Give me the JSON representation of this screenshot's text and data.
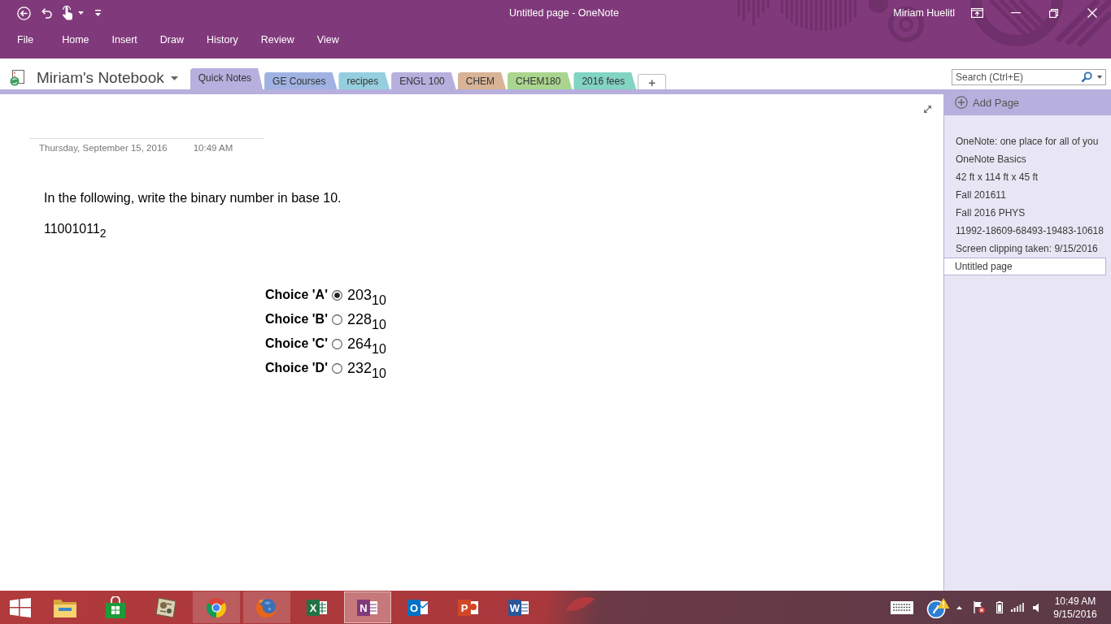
{
  "title_bar": {
    "title": "Untitled page - OneNote",
    "account": "Miriam Huelitl"
  },
  "ribbon_tabs": [
    "File",
    "Home",
    "Insert",
    "Draw",
    "History",
    "Review",
    "View"
  ],
  "notebook": {
    "name": "Miriam's Notebook"
  },
  "sections": [
    {
      "label": "Quick Notes",
      "selected": true,
      "color": "#b7afdd"
    },
    {
      "label": "GE Courses",
      "selected": false,
      "color": "#a0b2e2"
    },
    {
      "label": "recipes",
      "selected": false,
      "color": "#95cfdf"
    },
    {
      "label": "ENGL 100",
      "selected": false,
      "color": "#b7afdd"
    },
    {
      "label": "CHEM",
      "selected": false,
      "color": "#d8b396"
    },
    {
      "label": "CHEM180",
      "selected": false,
      "color": "#aad58f"
    },
    {
      "label": "2016 fees",
      "selected": false,
      "color": "#82d4c3"
    }
  ],
  "add_section_tab": "+",
  "search": {
    "placeholder": "Search (Ctrl+E)"
  },
  "page": {
    "date": "Thursday, September 15, 2016",
    "time": "10:49 AM",
    "question": "In the following, write the binary number in base 10.",
    "number": "11001011$_{2}$",
    "choices": [
      {
        "label": "Choice 'A'",
        "value": "203$_{10}$",
        "selected": true
      },
      {
        "label": "Choice 'B'",
        "value": "228$_{10}$",
        "selected": false
      },
      {
        "label": "Choice 'C'",
        "value": "264$_{10}$",
        "selected": false
      },
      {
        "label": "Choice 'D'",
        "value": "232$_{10}$",
        "selected": false
      }
    ]
  },
  "page_list": {
    "add_page": "Add Page",
    "pages": [
      {
        "title": "OneNote: one place for all of you",
        "selected": false
      },
      {
        "title": "OneNote Basics",
        "selected": false
      },
      {
        "title": "42 ft x 114 ft x 45 ft",
        "selected": false
      },
      {
        "title": "Fall 201611",
        "selected": false
      },
      {
        "title": "Fall 2016 PHYS",
        "selected": false
      },
      {
        "title": "11992-18609-68493-19483-10618",
        "selected": false
      },
      {
        "title": "Screen clipping taken: 9/15/2016",
        "selected": false
      },
      {
        "title": "Untitled page",
        "selected": true
      }
    ]
  },
  "taskbar": {
    "apps": [
      {
        "kind": "explorer",
        "running": false,
        "selected": false
      },
      {
        "kind": "store",
        "running": false,
        "selected": false
      },
      {
        "kind": "card",
        "running": false,
        "selected": false
      },
      {
        "kind": "chrome",
        "running": true,
        "selected": false
      },
      {
        "kind": "firefox",
        "running": true,
        "selected": false
      },
      {
        "kind": "excel",
        "letter": "X",
        "running": false,
        "selected": false
      },
      {
        "kind": "onenote",
        "letter": "N",
        "running": true,
        "selected": true
      },
      {
        "kind": "outlook",
        "letter": "O",
        "running": false,
        "selected": false
      },
      {
        "kind": "powerpoint",
        "letter": "P",
        "running": false,
        "selected": false
      },
      {
        "kind": "word",
        "letter": "W",
        "running": false,
        "selected": false
      }
    ],
    "time": "10:49 AM",
    "date": "9/15/2016"
  }
}
